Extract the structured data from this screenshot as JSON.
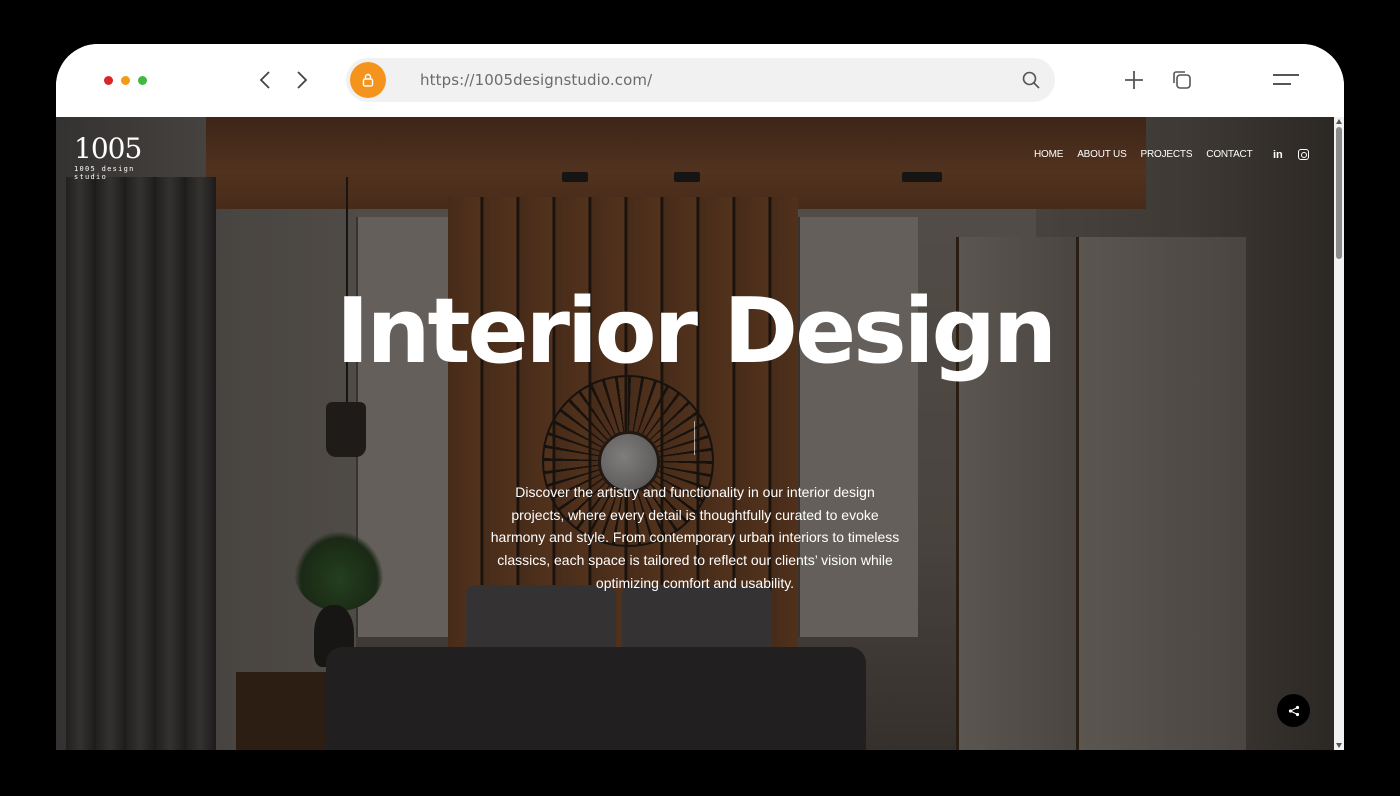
{
  "browser": {
    "url": "https://1005designstudio.com/",
    "accent": "#f4941c",
    "icons": [
      "back-arrow-icon",
      "forward-arrow-icon",
      "lock-icon",
      "search-icon",
      "plus-icon",
      "tabs-icon",
      "menu-icon"
    ]
  },
  "site": {
    "logo": {
      "main": "1005",
      "sub": "1005 design studio"
    },
    "nav": [
      {
        "label": "HOME"
      },
      {
        "label": "ABOUT US"
      },
      {
        "label": "PROJECTS"
      },
      {
        "label": "CONTACT"
      }
    ],
    "social": {
      "linkedin": "in",
      "instagram_icon": "instagram-icon"
    }
  },
  "hero": {
    "title": "Interior Design",
    "description": "Discover the artistry and functionality in our interior design projects, where every detail is thoughtfully curated to evoke harmony and style. From contemporary urban interiors to timeless classics, each space is tailored to reflect our clients’ vision while optimizing comfort and usability."
  },
  "share_button": {
    "icon": "share-icon"
  }
}
